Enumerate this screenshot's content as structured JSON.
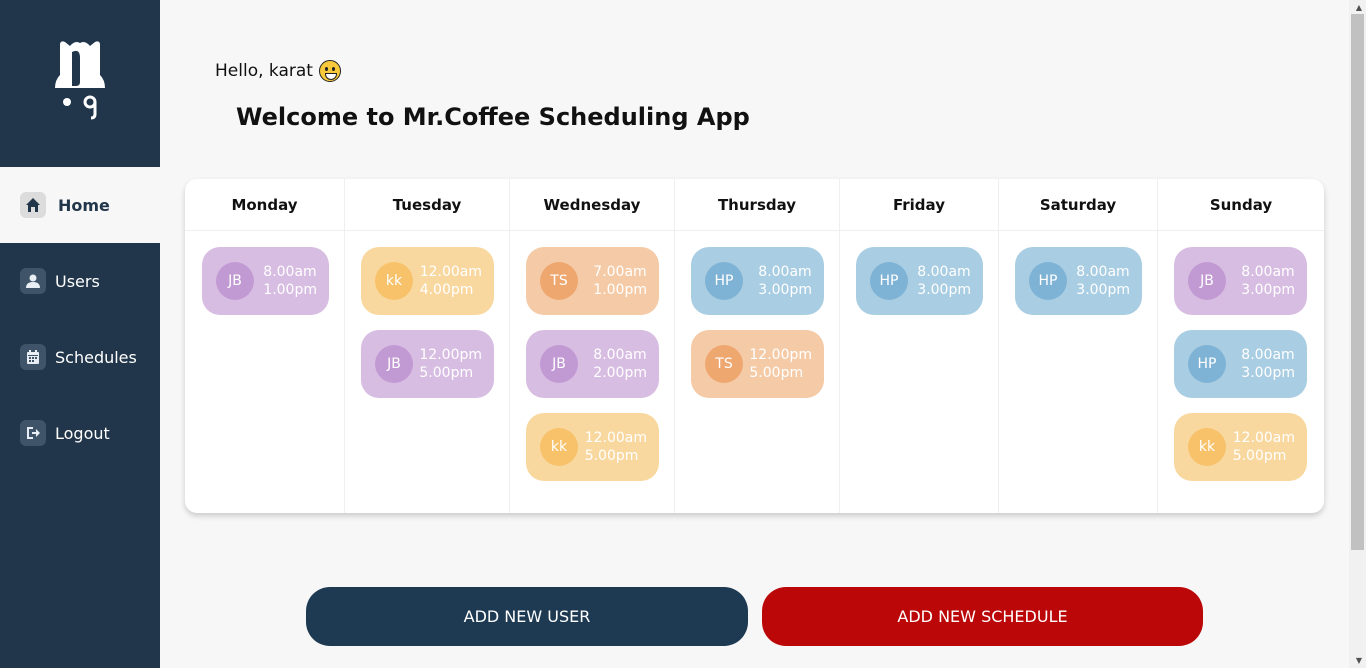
{
  "sidebar": {
    "items": [
      {
        "label": "Home",
        "icon": "home-icon"
      },
      {
        "label": "Users",
        "icon": "user-icon"
      },
      {
        "label": "Schedules",
        "icon": "calendar-icon"
      },
      {
        "label": "Logout",
        "icon": "logout-icon"
      }
    ],
    "active": "Home"
  },
  "header": {
    "greeting": "Hello, karat",
    "greeting_emoji": "smiley-icon",
    "title": "Welcome to Mr.Coffee Scheduling App"
  },
  "calendar": {
    "days": [
      {
        "name": "Monday",
        "shifts": [
          {
            "initials": "JB",
            "start": "8.00am",
            "end": "1.00pm",
            "color": "purple"
          }
        ]
      },
      {
        "name": "Tuesday",
        "shifts": [
          {
            "initials": "kk",
            "start": "12.00am",
            "end": "4.00pm",
            "color": "yellow"
          },
          {
            "initials": "JB",
            "start": "12.00pm",
            "end": "5.00pm",
            "color": "purple"
          }
        ]
      },
      {
        "name": "Wednesday",
        "shifts": [
          {
            "initials": "TS",
            "start": "7.00am",
            "end": "1.00pm",
            "color": "peach"
          },
          {
            "initials": "JB",
            "start": "8.00am",
            "end": "2.00pm",
            "color": "purple"
          },
          {
            "initials": "kk",
            "start": "12.00am",
            "end": "5.00pm",
            "color": "yellow"
          }
        ]
      },
      {
        "name": "Thursday",
        "shifts": [
          {
            "initials": "HP",
            "start": "8.00am",
            "end": "3.00pm",
            "color": "blue"
          },
          {
            "initials": "TS",
            "start": "12.00pm",
            "end": "5.00pm",
            "color": "peach"
          }
        ]
      },
      {
        "name": "Friday",
        "shifts": [
          {
            "initials": "HP",
            "start": "8.00am",
            "end": "3.00pm",
            "color": "blue"
          }
        ]
      },
      {
        "name": "Saturday",
        "shifts": [
          {
            "initials": "HP",
            "start": "8.00am",
            "end": "3.00pm",
            "color": "blue"
          }
        ]
      },
      {
        "name": "Sunday",
        "shifts": [
          {
            "initials": "JB",
            "start": "8.00am",
            "end": "3.00pm",
            "color": "purple"
          },
          {
            "initials": "HP",
            "start": "8.00am",
            "end": "3.00pm",
            "color": "blue"
          },
          {
            "initials": "kk",
            "start": "12.00am",
            "end": "5.00pm",
            "color": "yellow"
          }
        ]
      }
    ]
  },
  "actions": {
    "add_user": "ADD NEW USER",
    "add_schedule": "ADD NEW SCHEDULE"
  },
  "colors": {
    "sidebar_bg": "#21364a",
    "add_user_bg": "#1e3a53",
    "add_schedule_bg": "#bb0707",
    "purple": "#d8bde2",
    "yellow": "#f9d8a0",
    "peach": "#f5cba7",
    "blue": "#a9cde2"
  }
}
